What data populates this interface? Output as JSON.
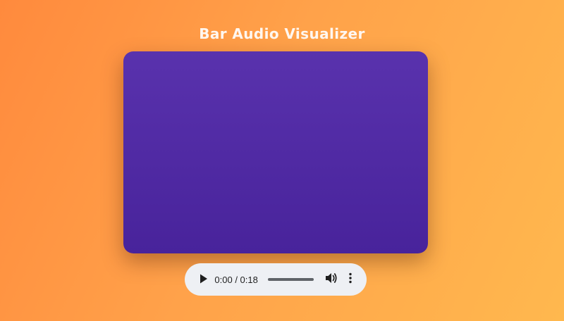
{
  "page": {
    "title": "Bar Audio Visualizer",
    "background_colors": [
      "#ff8a3d",
      "#ffb84e"
    ]
  },
  "visualizer": {
    "canvas_colors": [
      "#5932ad",
      "#48239b"
    ]
  },
  "player": {
    "current_time": "0:00",
    "duration": "0:18",
    "time_display": "0:00 / 0:18",
    "progress": 0,
    "icons": {
      "play": "play-icon",
      "volume": "volume-icon",
      "more": "more-options-icon"
    }
  }
}
